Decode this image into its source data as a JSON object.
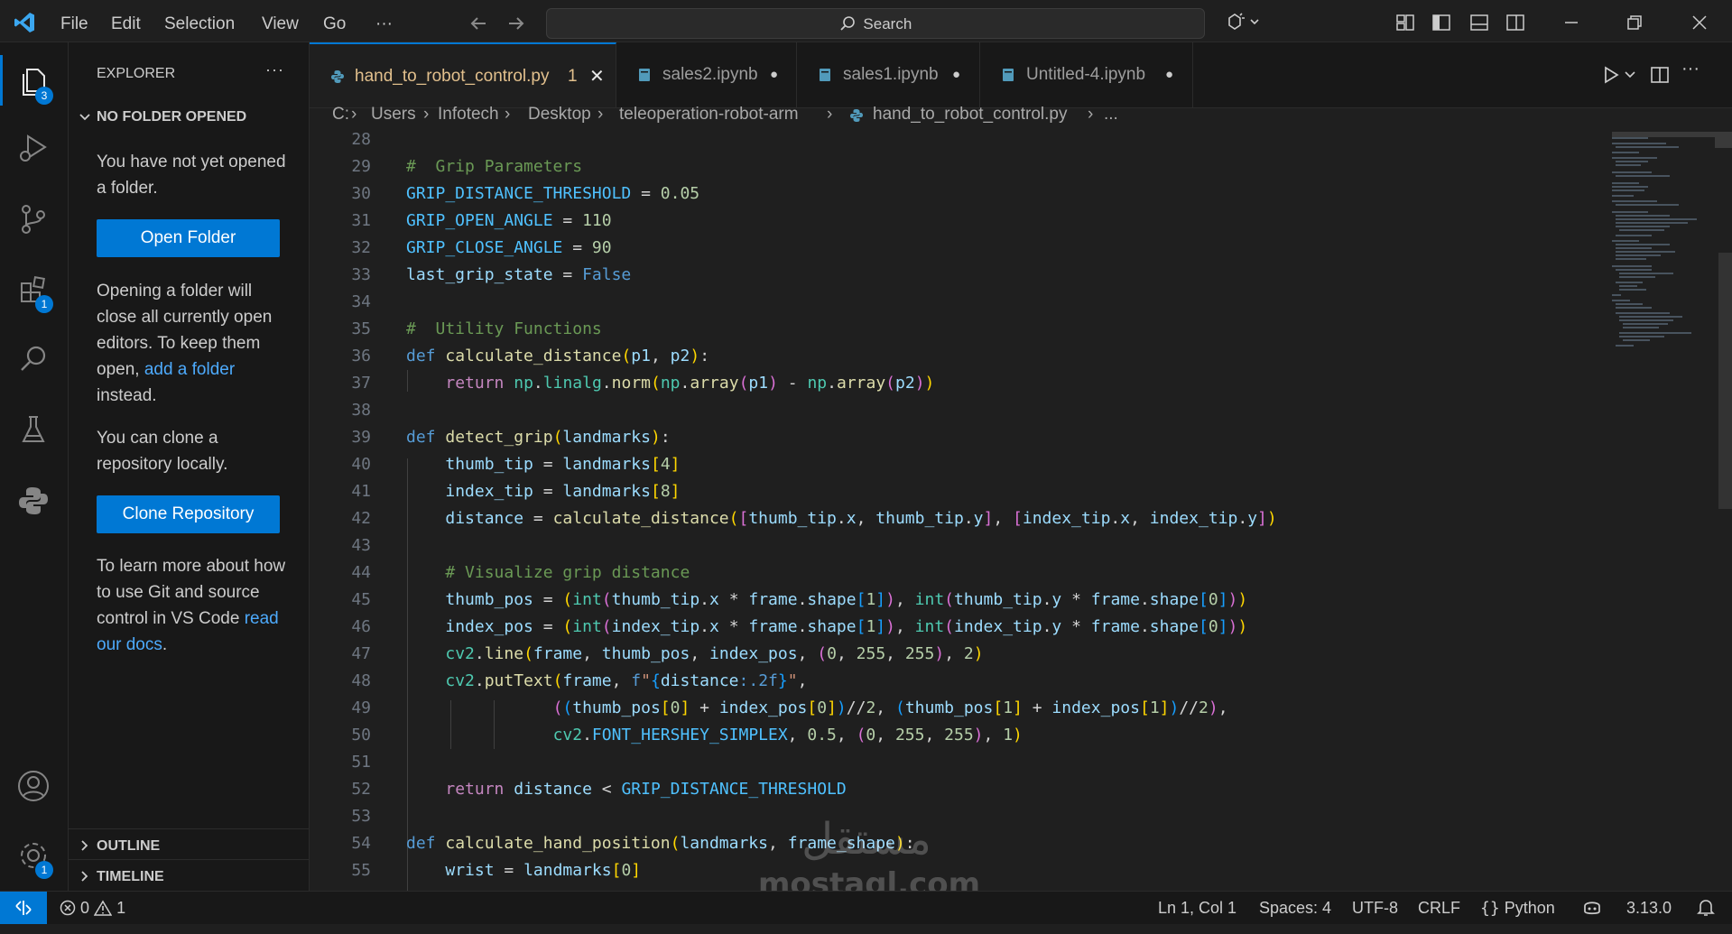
{
  "menu": [
    "File",
    "Edit",
    "Selection",
    "View",
    "Go",
    "···"
  ],
  "search": {
    "label": "Search"
  },
  "activity_bar": {
    "explorer_badge": "3",
    "extensions_badge": "1",
    "settings_badge": "1"
  },
  "sidebar": {
    "title": "EXPLORER",
    "more": "···",
    "section": "NO FOLDER OPENED",
    "msg1": "You have not yet opened a folder.",
    "open_folder_btn": "Open Folder",
    "msg2_a": "Opening a folder will close all currently open editors. To keep them open, ",
    "msg2_link": "add a folder",
    "msg2_b": " instead.",
    "msg3": "You can clone a repository locally.",
    "clone_btn": "Clone Repository",
    "msg4_a": "To learn more about how to use Git and source control in VS Code ",
    "msg4_link": "read our docs",
    "msg4_b": ".",
    "outline": "OUTLINE",
    "timeline": "TIMELINE"
  },
  "tabs": [
    {
      "label": "hand_to_robot_control.py",
      "problems": "1",
      "close": "✕"
    },
    {
      "label": "sales2.ipynb",
      "dirty": "●"
    },
    {
      "label": "sales1.ipynb",
      "dirty": "●"
    },
    {
      "label": "Untitled-4.ipynb",
      "dirty": "●"
    }
  ],
  "breadcrumb": [
    "C:",
    "Users",
    "Infotech",
    "Desktop",
    "teleoperation-robot-arm",
    "hand_to_robot_control.py",
    "..."
  ],
  "editor": {
    "line_numbers": [
      "28",
      "29",
      "30",
      "31",
      "32",
      "33",
      "34",
      "35",
      "36",
      "37",
      "38",
      "39",
      "40",
      "41",
      "42",
      "43",
      "44",
      "45",
      "46",
      "47",
      "48",
      "49",
      "50",
      "51",
      "52",
      "53",
      "54",
      "55"
    ]
  },
  "statusbar": {
    "errors": "0",
    "warnings": "1",
    "cursor": "Ln 1, Col 1",
    "spaces": "Spaces: 4",
    "encoding": "UTF-8",
    "eol": "CRLF",
    "language": "Python",
    "python_version": "3.13.0"
  },
  "watermark": {
    "arabic": "مستقل",
    "latin": "mostaql.com"
  },
  "colors": {
    "accent": "#0078d4",
    "modified_tab": "#e2c08d",
    "link": "#4daafc"
  }
}
